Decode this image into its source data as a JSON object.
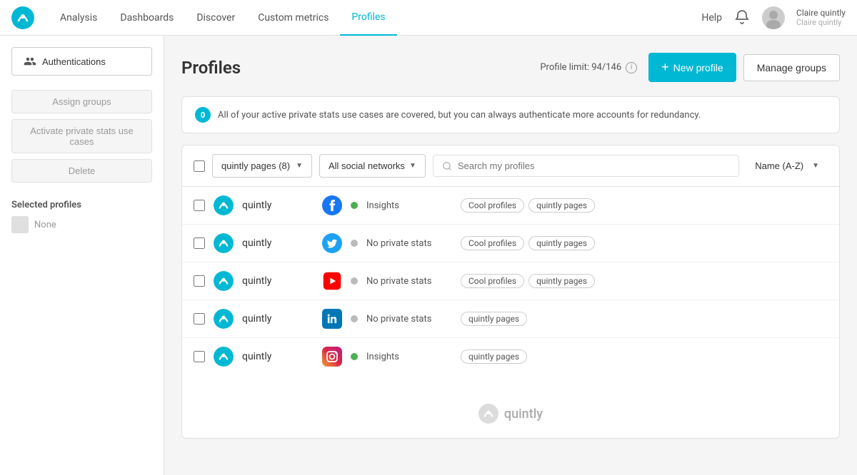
{
  "nav": {
    "links": [
      {
        "id": "analysis",
        "label": "Analysis",
        "active": false
      },
      {
        "id": "dashboards",
        "label": "Dashboards",
        "active": false
      },
      {
        "id": "discover",
        "label": "Discover",
        "active": false
      },
      {
        "id": "custom-metrics",
        "label": "Custom metrics",
        "active": false
      },
      {
        "id": "profiles",
        "label": "Profiles",
        "active": true
      }
    ],
    "help": "Help",
    "user_name": "Claire quintly",
    "user_subname": "Claire quintly"
  },
  "sidebar": {
    "auth_button": "Authentications",
    "assign_button": "Assign groups",
    "activate_button": "Activate private stats use cases",
    "delete_button": "Delete",
    "selected_title": "Selected profiles",
    "none_label": "None"
  },
  "page": {
    "title": "Profiles",
    "profile_limit_label": "Profile limit: 94/146",
    "new_profile_button": "New profile",
    "manage_groups_button": "Manage groups"
  },
  "alert": {
    "badge": "0",
    "message": "All of your active private stats use cases are covered, but you can always authenticate more accounts for redundancy."
  },
  "toolbar": {
    "group_filter": "quintly pages (8)",
    "social_filter": "All social networks",
    "search_placeholder": "Search my profiles",
    "sort_label": "Name (A-Z)"
  },
  "profiles": [
    {
      "name": "quintly",
      "platform": "facebook",
      "status": "green",
      "stat": "Insights",
      "tags": [
        "Cool profiles",
        "quintly pages"
      ]
    },
    {
      "name": "quintly",
      "platform": "twitter",
      "status": "gray",
      "stat": "No private stats",
      "tags": [
        "Cool profiles",
        "quintly pages"
      ]
    },
    {
      "name": "quintly",
      "platform": "youtube",
      "status": "gray",
      "stat": "No private stats",
      "tags": [
        "Cool profiles",
        "quintly pages"
      ]
    },
    {
      "name": "quintly",
      "platform": "linkedin",
      "status": "gray",
      "stat": "No private stats",
      "tags": [
        "quintly pages"
      ]
    },
    {
      "name": "quintly",
      "platform": "instagram",
      "status": "green",
      "stat": "Insights",
      "tags": [
        "quintly pages"
      ]
    }
  ],
  "footer": {
    "brand": "quintly"
  }
}
